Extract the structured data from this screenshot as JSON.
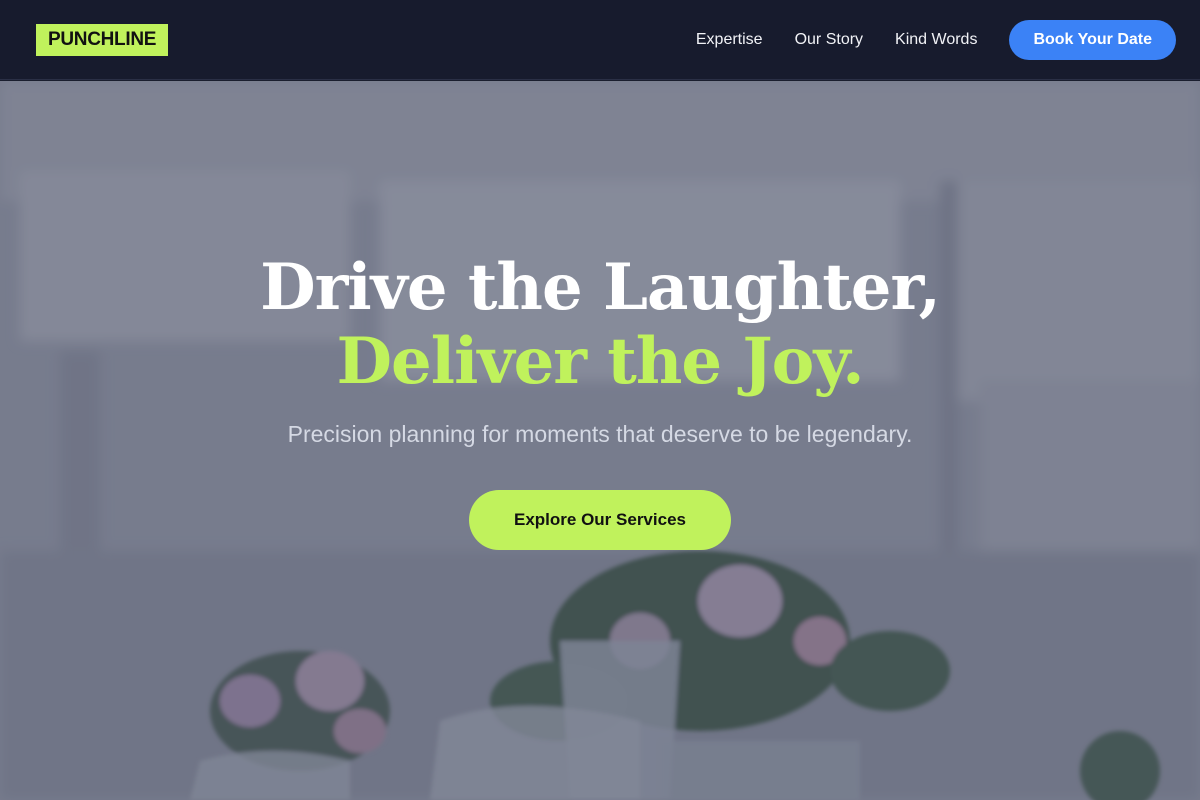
{
  "nav": {
    "logo": "PUNCHLINE",
    "links": [
      "Expertise",
      "Our Story",
      "Kind Words"
    ],
    "cta": "Book Your Date"
  },
  "hero": {
    "title_line1": "Drive the Laughter,",
    "title_line2": "Deliver the Joy.",
    "subtitle": "Precision planning for moments that deserve to be legendary.",
    "cta": "Explore Our Services"
  },
  "colors": {
    "nav_bg": "#171b2d",
    "accent_lime": "#c0f25c",
    "accent_blue": "#3b82f6",
    "overlay": "#42475c"
  }
}
